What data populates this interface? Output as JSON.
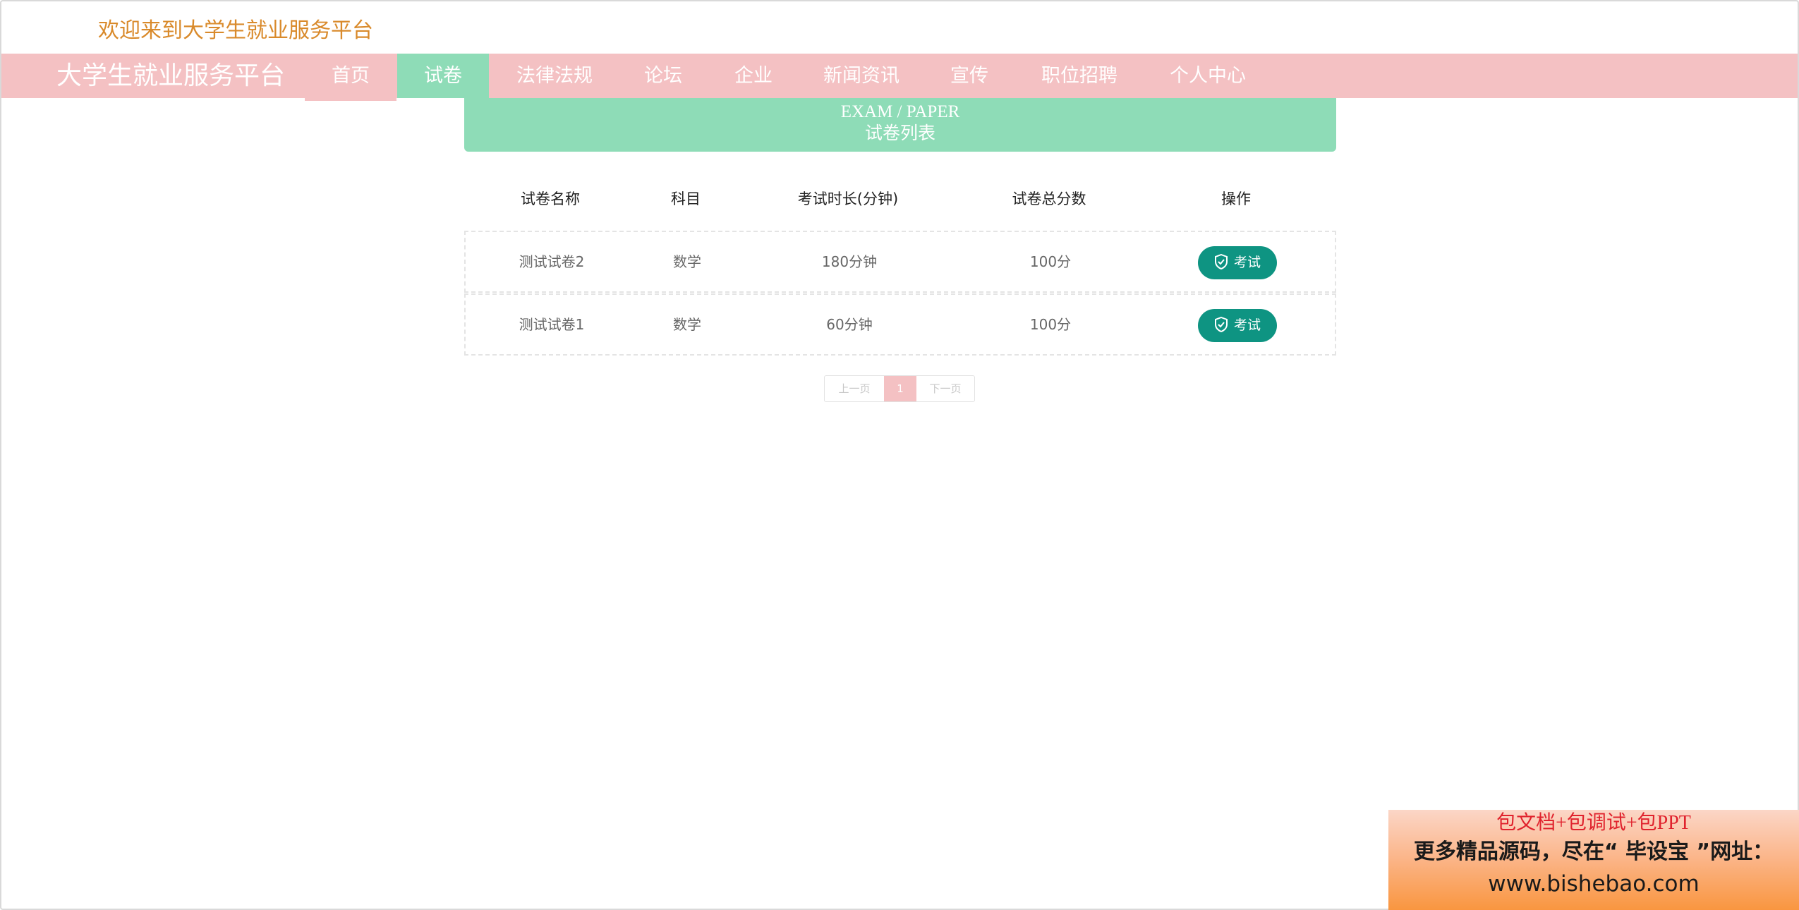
{
  "header": {
    "welcome_text": "欢迎来到大学生就业服务平台"
  },
  "navbar": {
    "brand": "大学生就业服务平台",
    "items": [
      {
        "label": "首页"
      },
      {
        "label": "试卷"
      },
      {
        "label": "法律法规"
      },
      {
        "label": "论坛"
      },
      {
        "label": "企业"
      },
      {
        "label": "新闻资讯"
      },
      {
        "label": "宣传"
      },
      {
        "label": "职位招聘"
      },
      {
        "label": "个人中心"
      }
    ],
    "active_index": 1
  },
  "banner": {
    "title_en": "EXAM / PAPER",
    "title_cn": "试卷列表"
  },
  "table": {
    "columns": [
      "试卷名称",
      "科目",
      "考试时长(分钟)",
      "试卷总分数",
      "操作"
    ],
    "rows": [
      {
        "name": "测试试卷2",
        "subject": "数学",
        "duration": "180分钟",
        "score": "100分",
        "action": "考试"
      },
      {
        "name": "测试试卷1",
        "subject": "数学",
        "duration": "60分钟",
        "score": "100分",
        "action": "考试"
      }
    ]
  },
  "pagination": {
    "prev": "上一页",
    "current": "1",
    "next": "下一页"
  },
  "ad": {
    "line1": "包文档+包调试+包PPT",
    "line2": "更多精品源码，尽在“ 毕设宝 ”网址：",
    "line3": "www.bishebao.com"
  },
  "colors": {
    "nav_bg": "#f4c1c3",
    "accent_green": "#8edcb7",
    "button_teal": "#0e9482",
    "welcome_orange": "#d98a2b"
  },
  "icons": {
    "exam_button_icon": "shield-check-icon"
  }
}
